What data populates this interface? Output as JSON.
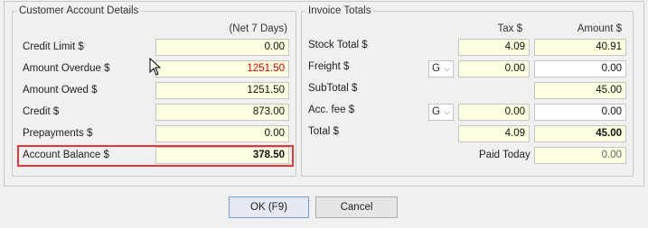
{
  "customer": {
    "title": "Customer Account Details",
    "period_header": "(Net 7 Days)",
    "rows": [
      {
        "label": "Credit Limit $",
        "value": "0.00"
      },
      {
        "label": "Amount Overdue $",
        "value": "1251.50"
      },
      {
        "label": "Amount Owed $",
        "value": "1251.50"
      },
      {
        "label": "Credit $",
        "value": "873.00"
      },
      {
        "label": "Prepayments $",
        "value": "0.00"
      },
      {
        "label": "Account Balance $",
        "value": "378.50"
      }
    ]
  },
  "invoice": {
    "title": "Invoice Totals",
    "tax_header": "Tax $",
    "amount_header": "Amount $",
    "stock_total": {
      "label": "Stock Total $",
      "tax": "4.09",
      "amount": "40.91"
    },
    "freight": {
      "label": "Freight $",
      "code": "G",
      "tax": "0.00",
      "amount": "0.00"
    },
    "subtotal": {
      "label": "SubTotal $",
      "amount": "45.00"
    },
    "acc_fee": {
      "label": "Acc. fee $",
      "code": "G",
      "tax": "0.00",
      "amount": "0.00"
    },
    "total": {
      "label": "Total $",
      "tax": "4.09",
      "amount": "45.00"
    },
    "paid_today": {
      "label": "Paid Today",
      "amount": "0.00"
    }
  },
  "buttons": {
    "ok": "OK (F9)",
    "cancel": "Cancel"
  },
  "colors": {
    "highlight": "#e0393b",
    "field_bg": "#ffffe1",
    "overdue_text": "#cc0000"
  }
}
